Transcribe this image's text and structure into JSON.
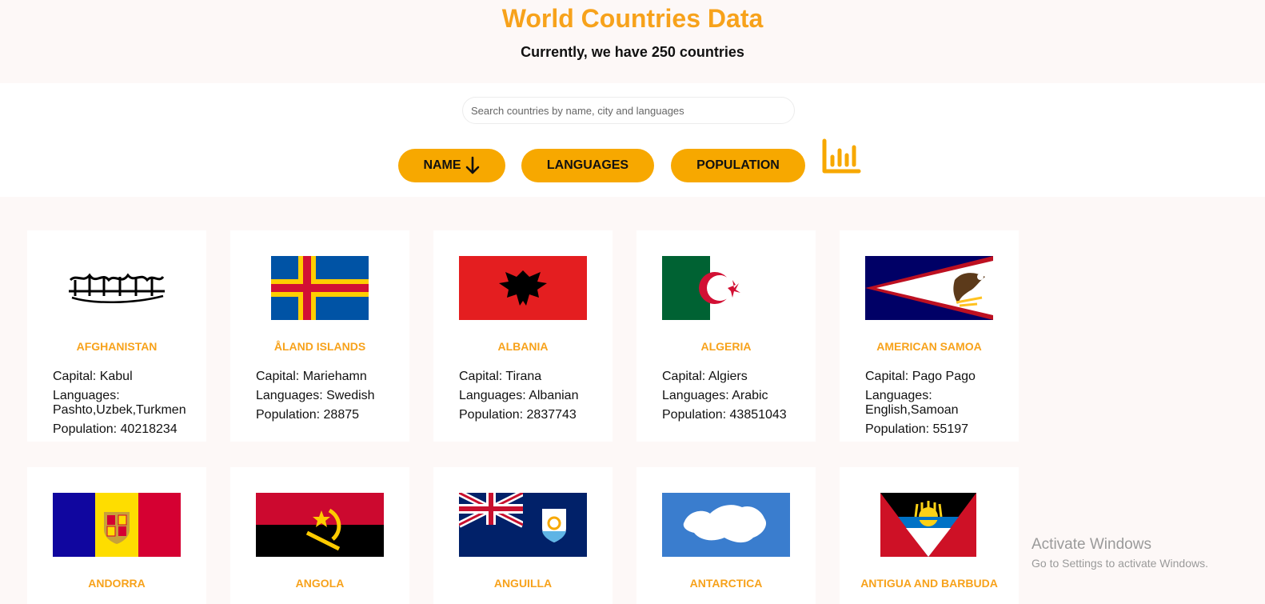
{
  "header": {
    "title": "World Countries Data",
    "subtitle": "Currently, we have 250 countries"
  },
  "search": {
    "placeholder": "Search countries by name, city and languages",
    "value": ""
  },
  "sort_buttons": {
    "name": "NAME",
    "languages": "LANGUAGES",
    "population": "POPULATION"
  },
  "labels": {
    "capital": "Capital:",
    "languages": "Languages:",
    "population": "Population:"
  },
  "countries": [
    {
      "name": "AFGHANISTAN",
      "capital": "Kabul",
      "languages": "Pashto,Uzbek,Turkmen",
      "population": "40218234"
    },
    {
      "name": "ÅLAND ISLANDS",
      "capital": "Mariehamn",
      "languages": "Swedish",
      "population": "28875"
    },
    {
      "name": "ALBANIA",
      "capital": "Tirana",
      "languages": "Albanian",
      "population": "2837743"
    },
    {
      "name": "ALGERIA",
      "capital": "Algiers",
      "languages": "Arabic",
      "population": "43851043"
    },
    {
      "name": "AMERICAN SAMOA",
      "capital": "Pago Pago",
      "languages": "English,Samoan",
      "population": "55197"
    },
    {
      "name": "ANDORRA"
    },
    {
      "name": "ANGOLA"
    },
    {
      "name": "ANGUILLA"
    },
    {
      "name": "ANTARCTICA"
    },
    {
      "name": "ANTIGUA AND BARBUDA"
    }
  ],
  "watermark": {
    "line1": "Activate Windows",
    "line2": "Go to Settings to activate Windows."
  },
  "colors": {
    "accent": "#f7a21b",
    "button": "#f7a800",
    "background": "#fdf8f7"
  }
}
